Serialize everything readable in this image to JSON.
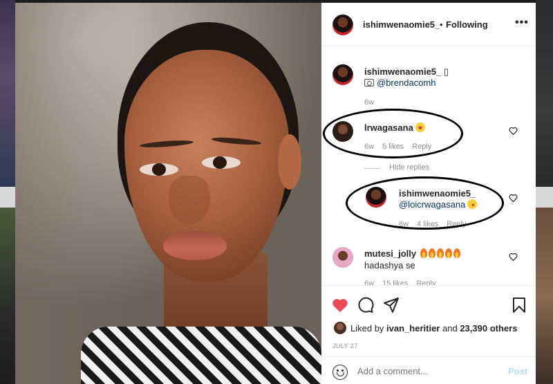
{
  "post": {
    "username": "ishimwenaomie5_",
    "separator": "•",
    "follow_status": "Following",
    "more_icon": "more-horizontal-icon",
    "caption": {
      "username": "ishimwenaomie5_",
      "tag_glyph": "▯",
      "photo_credit_mention": "@brendacomh",
      "age": "6w"
    }
  },
  "comments": [
    {
      "username": "lrwagasana",
      "emoji": "star-struck",
      "age": "6w",
      "likes": "5 likes",
      "reply_label": "Reply"
    },
    {
      "hide_replies_label": "Hide replies",
      "reply": {
        "username": "ishimwenaomie5_",
        "mention": "@loicrwagasana",
        "emoji": "kiss",
        "age": "6w",
        "likes": "4 likes",
        "reply_label": "Reply"
      }
    },
    {
      "username": "mutesi_jolly",
      "emoji": "fire x5",
      "text": "hadashya se",
      "age": "6w",
      "likes": "15 likes",
      "reply_label": "Reply"
    }
  ],
  "actions": {
    "like_liked": true,
    "liked_by_prefix": "Liked by",
    "liked_by_user": "ivan_heritier",
    "liked_by_and": "and",
    "others": "23,390 others",
    "date": "JULY 27",
    "comment_placeholder": "Add a comment...",
    "post_label": "Post"
  },
  "colors": {
    "like_red": "#ed4956",
    "link_blue": "#00376b",
    "post_disabled": "#b2dffc",
    "muted": "#8e8e8e"
  }
}
